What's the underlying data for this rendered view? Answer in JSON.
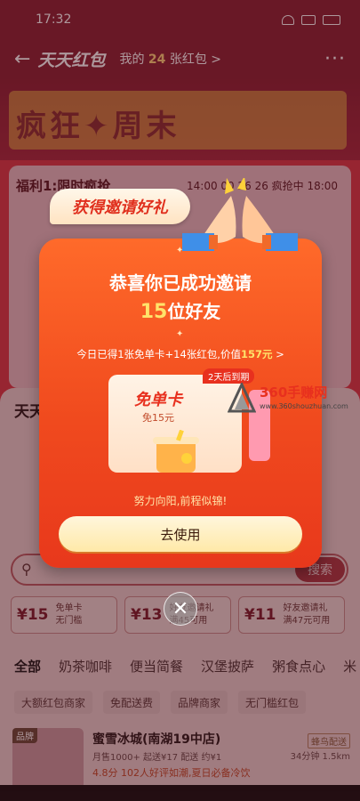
{
  "status_bar": {
    "time": "17:32"
  },
  "topbar": {
    "title": "天天红包",
    "my_red_prefix": "我的",
    "my_red_count": "24",
    "my_red_suffix": "张红包 >",
    "more": "···"
  },
  "banner": {
    "text": "疯狂✦周末"
  },
  "card1": {
    "title": "福利1:限时疯抢",
    "times": "14:00  00 26 26 疯抢中  18:00"
  },
  "card2": {
    "title": "天天"
  },
  "search": {
    "button": "搜索"
  },
  "coupons": [
    {
      "amount": "¥15",
      "line1": "免单卡",
      "line2": "无门槛"
    },
    {
      "amount": "¥13",
      "line1": "好友邀请礼",
      "line2": "满45可用"
    },
    {
      "amount": "¥11",
      "line1": "好友邀请礼",
      "line2": "满47元可用"
    }
  ],
  "category_tabs": [
    "全部",
    "奶茶咖啡",
    "便当简餐",
    "汉堡披萨",
    "粥食点心",
    "米"
  ],
  "filters": [
    "大额红包商家",
    "免配送费",
    "品牌商家",
    "无门槛红包"
  ],
  "shop": {
    "badge": "品牌",
    "name": "蜜雪冰城(南湖19中店)",
    "meta": "月售1000+  起送¥17  配送 约¥1",
    "score": "4.8分  102人好评如潮,夏日必备冷饮",
    "right_tag": "蜂鸟配送",
    "right_info": "34分钟 1.5km"
  },
  "modal": {
    "pill_title": "获得邀请好礼",
    "congrats": "恭喜你已成功邀请",
    "count": "15",
    "count_suffix": "位好友",
    "reward_prefix": "今日已得",
    "reward_cards": "1张免单卡",
    "reward_plus": "+14张红包,价值",
    "reward_value": "157元",
    "reward_arrow": " >",
    "expire_badge": "2天后到期",
    "ticket_label": "免单卡",
    "ticket_sub": "免15元",
    "slogan": "努力向阳,前程似锦!",
    "use_button": "去使用",
    "close": "✕"
  },
  "watermark": {
    "text": "360手赚网",
    "url": "www.360shouzhuan.com"
  },
  "colors": {
    "modal_orange": "#f04a1e",
    "highlight_yellow": "#ffe36a",
    "brand_red": "#e8301e"
  }
}
